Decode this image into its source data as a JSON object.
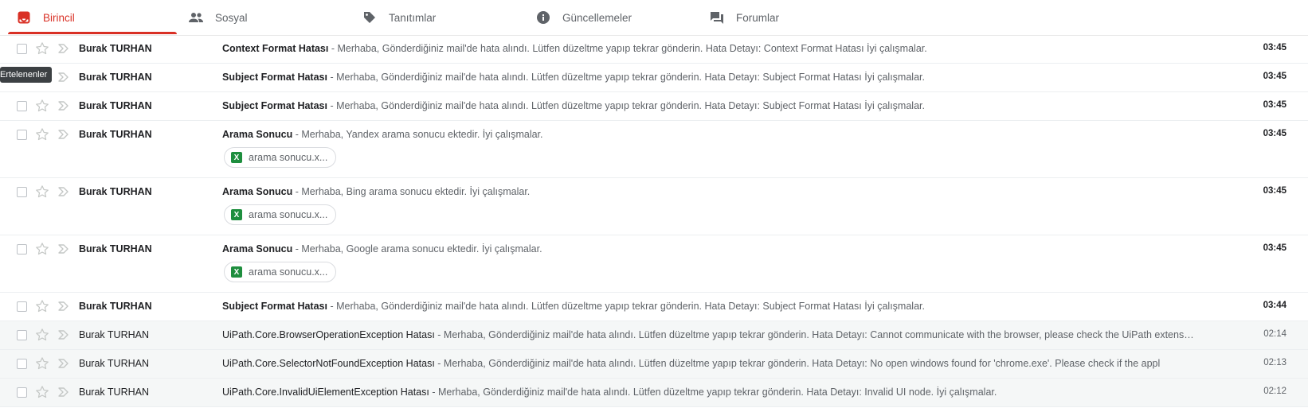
{
  "tabs": [
    {
      "label": "Birincil",
      "icon": "inbox-icon",
      "active": true
    },
    {
      "label": "Sosyal",
      "icon": "people-icon"
    },
    {
      "label": "Tanıtımlar",
      "icon": "tag-icon"
    },
    {
      "label": "Güncellemeler",
      "icon": "info-icon"
    },
    {
      "label": "Forumlar",
      "icon": "forum-icon"
    }
  ],
  "tooltip": "Ertelenenler",
  "colors": {
    "accent": "#d93025",
    "excel": "#1e8e3e"
  },
  "emails": [
    {
      "sender": "Burak TURHAN",
      "subject": "Context Format Hatası",
      "snippet": " - Merhaba, Gönderdiğiniz mail'de hata alındı. Lütfen düzeltme yapıp tekrar gönderin. Hata Detayı: Context Format Hatası İyi çalışmalar.",
      "time": "03:45",
      "unread": true
    },
    {
      "sender": "Burak TURHAN",
      "subject": "Subject Format Hatası",
      "snippet": " - Merhaba, Gönderdiğiniz mail'de hata alındı. Lütfen düzeltme yapıp tekrar gönderin. Hata Detayı: Subject Format Hatası İyi çalışmalar.",
      "time": "03:45",
      "unread": true
    },
    {
      "sender": "Burak TURHAN",
      "subject": "Subject Format Hatası",
      "snippet": " - Merhaba, Gönderdiğiniz mail'de hata alındı. Lütfen düzeltme yapıp tekrar gönderin. Hata Detayı: Subject Format Hatası İyi çalışmalar.",
      "time": "03:45",
      "unread": true
    },
    {
      "sender": "Burak TURHAN",
      "subject": "Arama Sonucu",
      "snippet": " - Merhaba, Yandex arama sonucu ektedir. İyi çalışmalar.",
      "time": "03:45",
      "unread": true,
      "attachment": "arama sonucu.x..."
    },
    {
      "sender": "Burak TURHAN",
      "subject": "Arama Sonucu",
      "snippet": " - Merhaba, Bing arama sonucu ektedir. İyi çalışmalar.",
      "time": "03:45",
      "unread": true,
      "attachment": "arama sonucu.x..."
    },
    {
      "sender": "Burak TURHAN",
      "subject": "Arama Sonucu",
      "snippet": " - Merhaba, Google arama sonucu ektedir. İyi çalışmalar.",
      "time": "03:45",
      "unread": true,
      "attachment": "arama sonucu.x..."
    },
    {
      "sender": "Burak TURHAN",
      "subject": "Subject Format Hatası",
      "snippet": " - Merhaba, Gönderdiğiniz mail'de hata alındı. Lütfen düzeltme yapıp tekrar gönderin. Hata Detayı: Subject Format Hatası İyi çalışmalar.",
      "time": "03:44",
      "unread": true
    },
    {
      "sender": "Burak TURHAN",
      "subject": "UiPath.Core.BrowserOperationException Hatası",
      "snippet": " - Merhaba, Gönderdiğiniz mail'de hata alındı. Lütfen düzeltme yapıp tekrar gönderin. Hata Detayı: Cannot communicate with the browser, please check the UiPath extens…",
      "time": "02:14",
      "unread": false
    },
    {
      "sender": "Burak TURHAN",
      "subject": "UiPath.Core.SelectorNotFoundException Hatası",
      "snippet": " - Merhaba, Gönderdiğiniz mail'de hata alındı. Lütfen düzeltme yapıp tekrar gönderin. Hata Detayı: No open windows found for 'chrome.exe'. Please check if the appl",
      "time": "02:13",
      "unread": false
    },
    {
      "sender": "Burak TURHAN",
      "subject": "UiPath.Core.InvalidUiElementException Hatası",
      "snippet": " - Merhaba, Gönderdiğiniz mail'de hata alındı. Lütfen düzeltme yapıp tekrar gönderin. Hata Detayı: Invalid UI node. İyi çalışmalar.",
      "time": "02:12",
      "unread": false
    }
  ]
}
